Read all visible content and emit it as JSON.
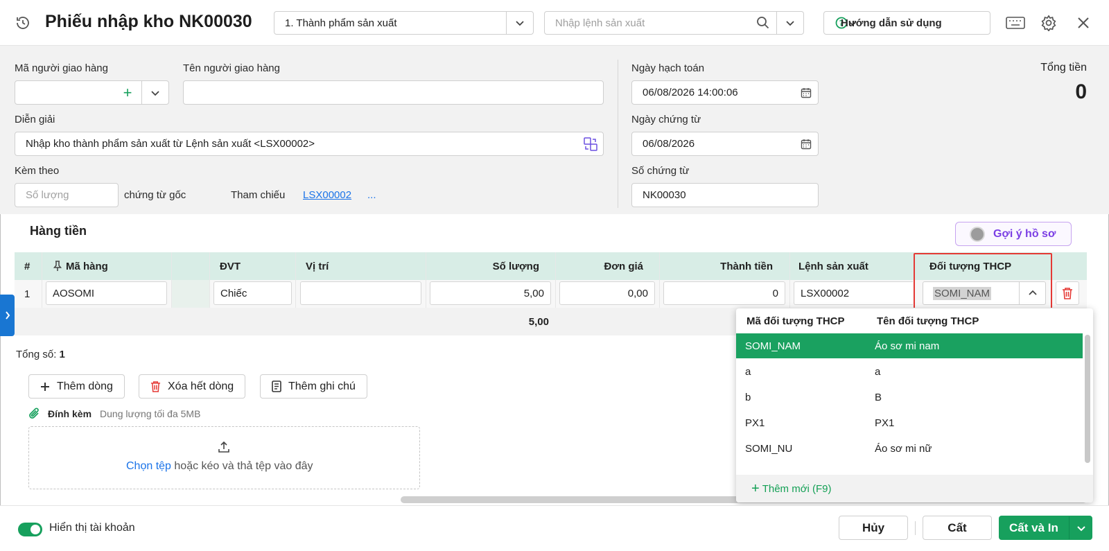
{
  "header": {
    "title": "Phiếu nhập kho NK00030",
    "type_select": "1. Thành phẩm sản xuất",
    "search_placeholder": "Nhập lệnh sản xuất",
    "guide_label": "Hướng dẫn sử dụng"
  },
  "form": {
    "deliverer_code_label": "Mã người giao hàng",
    "deliverer_code_value": "",
    "deliverer_name_label": "Tên người giao hàng",
    "deliverer_name_value": "",
    "description_label": "Diễn giải",
    "description_value": "Nhập kho thành phẩm sản xuất từ Lệnh sản xuất <LSX00002>",
    "attach_label": "Kèm theo",
    "attach_placeholder": "Số lượng",
    "attach_suffix": "chứng từ gốc",
    "reference_label": "Tham chiếu",
    "reference_link": "LSX00002",
    "reference_more": "...",
    "posting_date_label": "Ngày hạch toán",
    "posting_date_value": "06/08/2026 14:00:06",
    "voucher_date_label": "Ngày chứng từ",
    "voucher_date_value": "06/08/2026",
    "voucher_no_label": "Số chứng từ",
    "voucher_no_value": "NK00030",
    "total_label": "Tổng tiền",
    "total_value": "0"
  },
  "grid": {
    "title": "Hàng tiền",
    "suggest_label": "Gợi ý hồ sơ",
    "columns": [
      "#",
      "Mã hàng",
      "ĐVT",
      "Vị trí",
      "Số lượng",
      "Đơn giá",
      "Thành tiền",
      "Lệnh sản xuất",
      "Đối tượng THCP"
    ],
    "row": {
      "index": "1",
      "item_code": "AOSOMI",
      "unit": "Chiếc",
      "location": "",
      "quantity": "5,00",
      "unit_price": "0,00",
      "amount": "0",
      "production_order": "LSX00002",
      "cost_object": "SOMI_NAM"
    },
    "sum_quantity": "5,00",
    "total_count_label": "Tổng số:",
    "total_count_value": "1"
  },
  "actions": {
    "add_row": "Thêm dòng",
    "delete_all": "Xóa hết dòng",
    "add_note": "Thêm ghi chú"
  },
  "attachment": {
    "label": "Đính kèm",
    "limit": "Dung lượng tối đa 5MB",
    "choose_file": "Chọn tệp",
    "drop_hint": "hoặc kéo và thả tệp vào đây"
  },
  "dropdown": {
    "col_code": "Mã đối tượng THCP",
    "col_name": "Tên đối tượng THCP",
    "items": [
      {
        "code": "SOMI_NAM",
        "name": "Áo sơ mi nam",
        "selected": true
      },
      {
        "code": "a",
        "name": "a",
        "selected": false
      },
      {
        "code": "b",
        "name": "B",
        "selected": false
      },
      {
        "code": "PX1",
        "name": "PX1",
        "selected": false
      },
      {
        "code": "SOMI_NU",
        "name": "Áo sơ mi nữ",
        "selected": false
      }
    ],
    "add_new": "Thêm mới (F9)"
  },
  "footer": {
    "show_account": "Hiển thị tài khoản",
    "cancel": "Hủy",
    "save": "Cất",
    "save_print": "Cất và In"
  },
  "colors": {
    "accent_green": "#17a05d",
    "grid_header": "#d8ede6",
    "highlight_red": "#e53935",
    "link_blue": "#1a73e8"
  }
}
